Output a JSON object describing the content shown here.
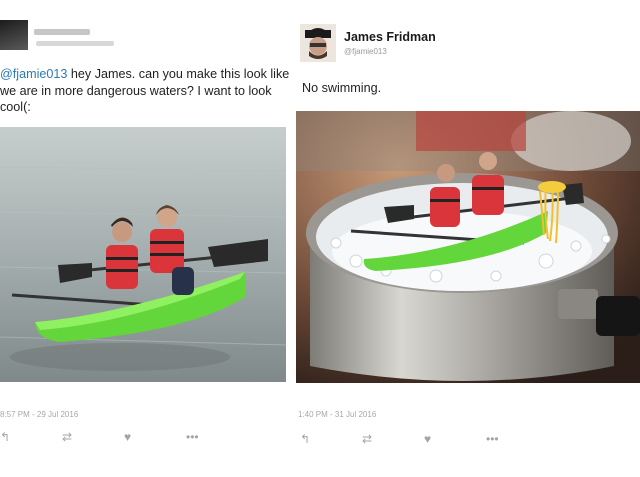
{
  "left_tweet": {
    "mention": "@fjamie013",
    "text": " hey James. can you make this look like we are in more dangerous waters? I want to look cool(:",
    "timestamp": "8:57 PM - 29 Jul 2016"
  },
  "right_tweet": {
    "name": "James Fridman",
    "handle": "@fjamie013",
    "text": "No swimming.",
    "timestamp": "1:40 PM - 31 Jul 2016"
  },
  "actions": {
    "reply": "↰",
    "retweet": "⇄",
    "like": "♥",
    "more": "•••"
  },
  "colors": {
    "kayak": "#62d63a",
    "lifejacket": "#d9353a",
    "water": "#9aa7a9",
    "pot": "#b8b8b4",
    "link": "#2b7bb9"
  }
}
